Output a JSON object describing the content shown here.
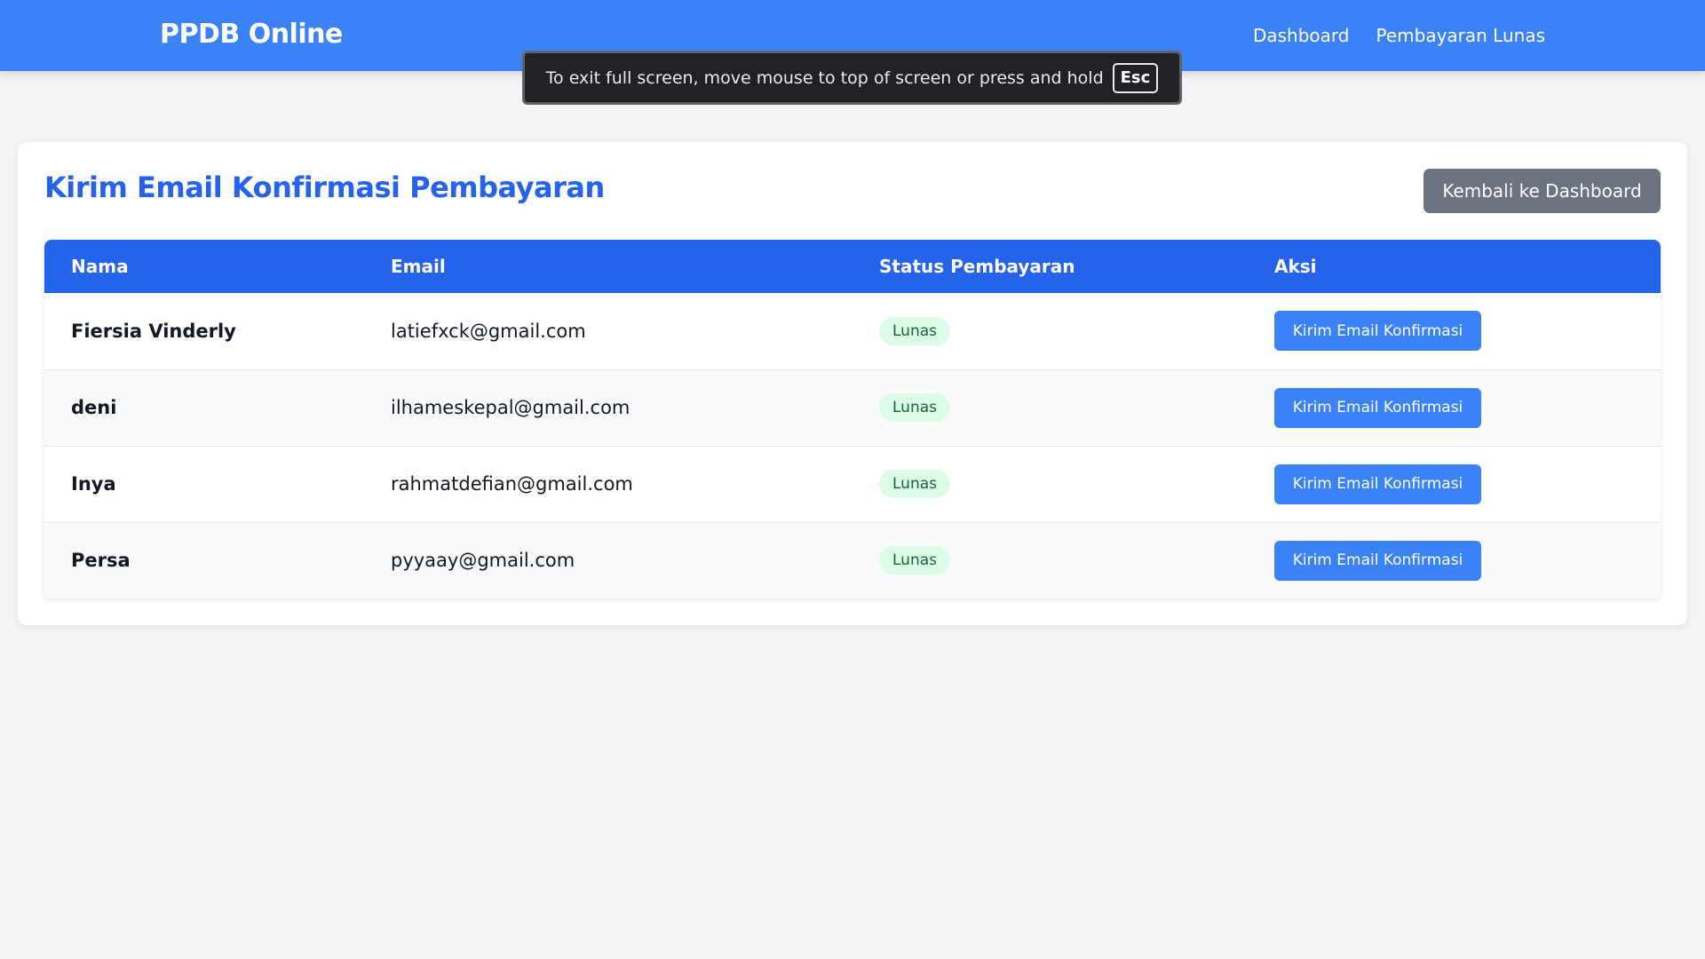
{
  "navbar": {
    "brand": "PPDB Online",
    "links": [
      {
        "label": "Dashboard"
      },
      {
        "label": "Pembayaran Lunas"
      }
    ]
  },
  "fullscreen_notice": {
    "message": "To exit full screen, move mouse to top of screen or press and hold",
    "key": "Esc"
  },
  "page": {
    "title": "Kirim Email Konfirmasi Pembayaran",
    "back_button": "Kembali ke Dashboard"
  },
  "table": {
    "headers": [
      "Nama",
      "Email",
      "Status Pembayaran",
      "Aksi"
    ],
    "rows": [
      {
        "nama": "Fiersia Vinderly",
        "email": "latiefxck@gmail.com",
        "status": "Lunas",
        "action": "Kirim Email Konfirmasi"
      },
      {
        "nama": "deni",
        "email": "ilhameskepal@gmail.com",
        "status": "Lunas",
        "action": "Kirim Email Konfirmasi"
      },
      {
        "nama": "Inya",
        "email": "rahmatdefian@gmail.com",
        "status": "Lunas",
        "action": "Kirim Email Konfirmasi"
      },
      {
        "nama": "Persa",
        "email": "pyyaay@gmail.com",
        "status": "Lunas",
        "action": "Kirim Email Konfirmasi"
      }
    ]
  },
  "colors": {
    "navbar": "#3b82f6",
    "title": "#2563eb",
    "table_header": "#2563eb",
    "badge_bg": "#dcfce7",
    "badge_text": "#166534",
    "back_button": "#6b7280"
  }
}
